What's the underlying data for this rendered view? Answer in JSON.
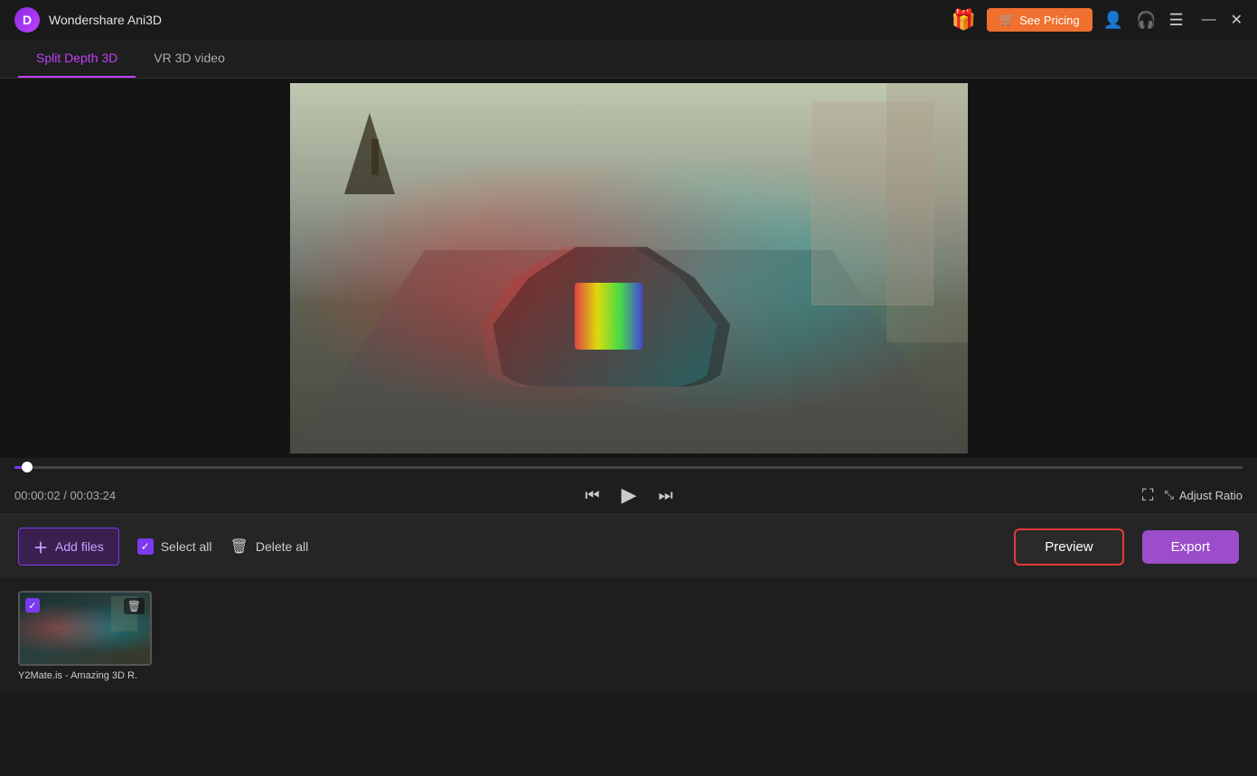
{
  "app": {
    "logo_letter": "D",
    "title": "Wondershare Ani3D"
  },
  "titlebar": {
    "gift_icon": "🎁",
    "see_pricing_label": "See Pricing",
    "see_pricing_icon": "🛒",
    "minimize_icon": "—",
    "close_icon": "✕"
  },
  "tabs": [
    {
      "id": "split-depth",
      "label": "Split Depth 3D",
      "active": true
    },
    {
      "id": "vr-3d",
      "label": "VR 3D video",
      "active": false
    }
  ],
  "player": {
    "current_time": "00:00:02",
    "total_time": "00:03:24",
    "progress_percent": 1
  },
  "toolbar": {
    "add_files_label": "Add files",
    "select_all_label": "Select all",
    "delete_all_label": "Delete all",
    "preview_label": "Preview",
    "export_label": "Export"
  },
  "files": [
    {
      "name": "Y2Mate.is - Amazing 3D R.",
      "checked": true
    }
  ],
  "controls": {
    "skip_back_icon": "⏮",
    "play_icon": "▶",
    "skip_fwd_icon": "⏭",
    "fullscreen_icon": "⛶",
    "adjust_ratio_label": "Adjust Ratio",
    "aspect_icon": "⤡"
  }
}
